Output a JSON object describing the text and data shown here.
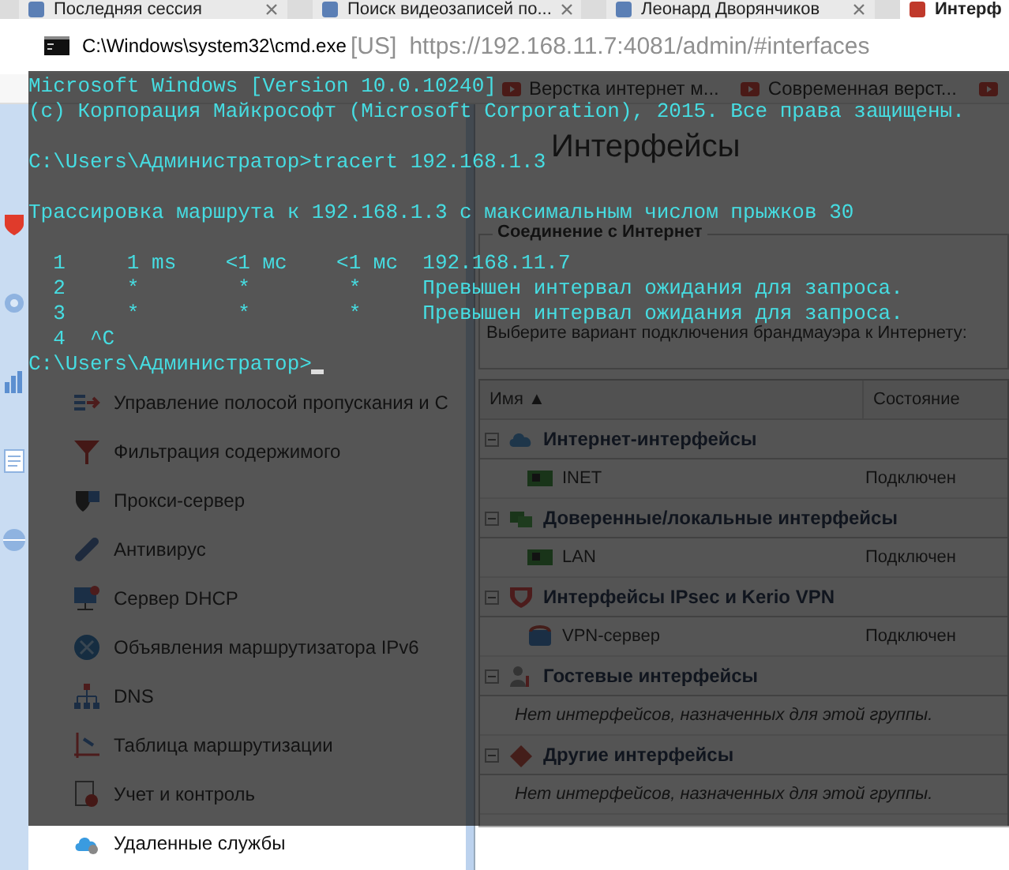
{
  "browser": {
    "tabs": [
      {
        "title": "Последняя сессия",
        "selected": false
      },
      {
        "title": "Поиск видеозаписей по...",
        "selected": false
      },
      {
        "title": "Леонард Дворянчиков",
        "selected": false
      },
      {
        "title": "Интерф",
        "selected": true
      }
    ],
    "address": {
      "region": "[US]",
      "url": "https://192.168.11.7:4081/admin/#interfaces"
    },
    "bookmarks": [
      "Верстка интернет м...",
      "Современная верст..."
    ]
  },
  "sidebar": {
    "items": [
      "Управление полосой пропускания и С",
      "Фильтрация содержимого",
      "Прокси-сервер",
      "Антивирус",
      "Сервер DHCP",
      "Объявления маршрутизатора IPv6",
      "DNS",
      "Таблица маршрутизации",
      "Учет и контроль",
      "Удаленные службы"
    ]
  },
  "page": {
    "title": "Интерфейсы",
    "connection": {
      "legend": "Соединение с Интернет",
      "text": "Выберите вариант подключения брандмауэра к Интернету:"
    },
    "table": {
      "columns": [
        "Имя ▲",
        "Состояние"
      ],
      "groups": [
        {
          "name": "Интернет-интерфейсы",
          "expanded": true,
          "rows": [
            {
              "name": "INET",
              "status": "Подключен"
            }
          ]
        },
        {
          "name": "Доверенные/локальные интерфейсы",
          "expanded": true,
          "rows": [
            {
              "name": "LAN",
              "status": "Подключен"
            }
          ]
        },
        {
          "name": "Интерфейсы IPsec и Kerio VPN",
          "expanded": true,
          "rows": [
            {
              "name": "VPN-сервер",
              "status": "Подключен"
            }
          ]
        },
        {
          "name": "Гостевые интерфейсы",
          "expanded": true,
          "empty_text": "Нет интерфейсов, назначенных для этой группы."
        },
        {
          "name": "Другие интерфейсы",
          "expanded": true,
          "empty_text": "Нет интерфейсов, назначенных для этой группы."
        }
      ]
    }
  },
  "console": {
    "title": "C:\\Windows\\system32\\cmd.exe",
    "paragraphs": [
      [
        "Microsoft Windows [Version 10.0.10240]",
        "(c) Корпорация Майкрософт (Microsoft Corporation), 2015. Все права защищены."
      ],
      [
        "C:\\Users\\Администратор>tracert 192.168.1.3"
      ],
      [
        "Трассировка маршрута к 192.168.1.3 с максимальным числом прыжков 30"
      ],
      [
        "  1     1 ms    <1 мс    <1 мс  192.168.11.7",
        "  2     *        *        *     Превышен интервал ожидания для запроса.",
        "  3     *        *        *     Превышен интервал ожидания для запроса.",
        "  4  ^C",
        "C:\\Users\\Администратор>"
      ]
    ],
    "cursor": true
  }
}
